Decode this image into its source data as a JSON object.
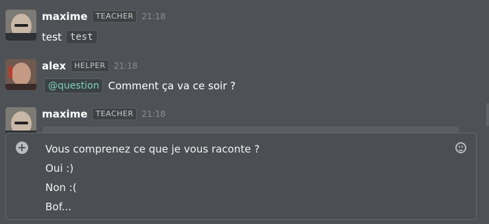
{
  "messages": [
    {
      "author": "maxime",
      "role": "TEACHER",
      "time": "21:18",
      "text": "test",
      "code": "test"
    },
    {
      "author": "alex",
      "role": "HELPER",
      "time": "21:18",
      "mention": "@question",
      "text": "Comment ça va ce soir ?"
    },
    {
      "author": "maxime",
      "role": "TEACHER",
      "time": "21:18"
    }
  ],
  "composer": {
    "lines": [
      "Vous comprenez ce que je vous raconte ?",
      "Oui :)",
      "Non :(",
      "Bof..."
    ],
    "plus_icon": "plus-circle-icon",
    "emoji_icon": "smiley-icon"
  },
  "colors": {
    "background": "#4e5256",
    "mention": "#7dd1c5",
    "role_badge": "#3f4245"
  }
}
